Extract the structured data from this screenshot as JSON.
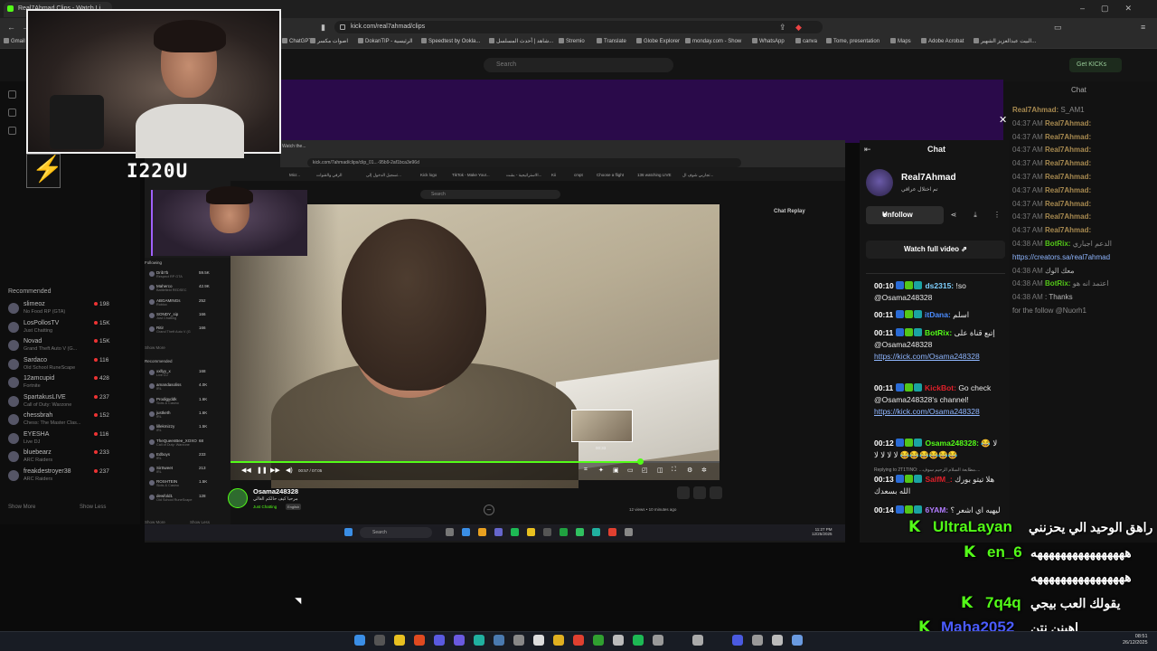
{
  "browser": {
    "tab_title": "Real7Ahmad Clips - Watch Li...",
    "url": "kick.com/real7ahmad/clips",
    "bookmarks": [
      "Gmail",
      "ChatGPT",
      "اصوات مكسر",
      "DokanTIP - الرئيسية",
      "Speedtest by Ookla...",
      "شاهد | أحدث المسلسل...",
      "Stremio",
      "Translate",
      "Globe Explorer",
      "monday.com - Show",
      "WhatsApp",
      "canva",
      "Tome, presentation",
      "Maps",
      "Adobe Acrobat",
      "البيت عبدالعزيز الشهير..."
    ]
  },
  "kick": {
    "search_placeholder": "Search",
    "get_kicks": "Get KICKs",
    "chat_title": "Chat",
    "recommended_heading": "Recommended",
    "recommended": [
      {
        "name": "slimeoz",
        "category": "No Food RP (GTA)",
        "viewers": "198"
      },
      {
        "name": "LosPollosTV",
        "category": "Just Chatting",
        "viewers": "15K"
      },
      {
        "name": "Novad",
        "category": "Grand Theft Auto V (G...",
        "viewers": "15K"
      },
      {
        "name": "Sardaco",
        "category": "Old School RuneScape",
        "viewers": "116"
      },
      {
        "name": "12amcupid",
        "category": "Fortnite",
        "viewers": "428"
      },
      {
        "name": "SpartakusLIVE",
        "category": "Call of Duty: Warzone",
        "viewers": "237"
      },
      {
        "name": "chessbrah",
        "category": "Chess: The Master Clas...",
        "viewers": "152"
      },
      {
        "name": "EYESHA",
        "category": "Live DJ",
        "viewers": "116"
      },
      {
        "name": "bluebearz",
        "category": "ARC Raiders",
        "viewers": "233"
      },
      {
        "name": "freakdestroyer38",
        "category": "ARC Raiders",
        "viewers": "237"
      }
    ],
    "show_more": "Show More",
    "show_less": "Show Less",
    "bg_chat": [
      {
        "time": "",
        "user": "Real7Ahmad:",
        "msg": "S_AM1",
        "style": "u"
      },
      {
        "time": "04:37 AM",
        "user": "Real7Ahmad:",
        "msg": "",
        "style": "u"
      },
      {
        "time": "04:37 AM",
        "user": "Real7Ahmad:",
        "msg": "",
        "style": "u"
      },
      {
        "time": "04:37 AM",
        "user": "Real7Ahmad:",
        "msg": "",
        "style": "u"
      },
      {
        "time": "04:37 AM",
        "user": "Real7Ahmad:",
        "msg": "",
        "style": "u"
      },
      {
        "time": "04:37 AM",
        "user": "Real7Ahmad:",
        "msg": "",
        "style": "u"
      },
      {
        "time": "04:37 AM",
        "user": "Real7Ahmad:",
        "msg": "",
        "style": "u"
      },
      {
        "time": "04:37 AM",
        "user": "Real7Ahmad:",
        "msg": "",
        "style": "u"
      },
      {
        "time": "04:37 AM",
        "user": "Real7Ahmad:",
        "msg": "",
        "style": "u"
      },
      {
        "time": "04:37 AM",
        "user": "Real7Ahmad:",
        "msg": "",
        "style": "u"
      },
      {
        "time": "04:38 AM",
        "user": "BotRix:",
        "msg": "الدعم اجباري",
        "style": "ub"
      },
      {
        "time": "",
        "user": "",
        "msg": "https://creators.sa/real7ahmad",
        "style": "link"
      },
      {
        "time": "04:38 AM",
        "user": "",
        "msg": "معك الوك",
        "style": "ur"
      },
      {
        "time": "04:38 AM",
        "user": "BotRix:",
        "msg": "اعتمد انه هو",
        "style": "ub"
      },
      {
        "time": "04:38 AM",
        "user": "",
        "msg": ": Thanks",
        "style": "ur"
      },
      {
        "time": "",
        "user": "",
        "msg": "for the follow @Nuorh1",
        "style": "plain"
      }
    ]
  },
  "modal": {
    "inner_url": "kick.com/7ahmad/clips/clip_01...-95b9-2af1bca3e96d",
    "inner_tab": "Watch the...",
    "inner_bookmarks": [
      "Micr...",
      "الرقي والقنوات",
      "تسجيل الدخول إلى...",
      "Kick logo",
      "TikTok - Make Your...",
      "الاستراتيجية - بشت...",
      "Kii",
      "cmpt",
      "Choose a flight",
      "136 watching LIVE",
      "تجاربي شوف ال..."
    ],
    "inner_search": "Search",
    "chat_replay": "Chat Replay",
    "inner_following_label": "Following",
    "inner_following": [
      {
        "name": "Drib7b",
        "category": "Respect RP GTA",
        "viewers": "59.5K"
      },
      {
        "name": "Maherco",
        "category": "Battlefield REDSEC",
        "viewers": "42.9K"
      },
      {
        "name": "ABGAMINGs",
        "category": "Roblox",
        "viewers": "252"
      },
      {
        "name": "SONDY_sip",
        "category": "Just Chatting",
        "viewers": "166"
      },
      {
        "name": "Ritir",
        "category": "Grand Theft Auto V (G",
        "viewers": "166"
      }
    ],
    "inner_show_more": "Show More",
    "inner_recommended_label": "Recommended",
    "inner_recommended": [
      {
        "name": "xxllyy_x",
        "category": "Live DJ",
        "viewers": "168"
      },
      {
        "name": "amandasoliss",
        "category": "IRL",
        "viewers": "4.0K"
      },
      {
        "name": "Prodigyddk",
        "category": "Slots & Casino",
        "viewers": "1.6K"
      },
      {
        "name": "justketh",
        "category": "IRL",
        "viewers": "1.6K"
      },
      {
        "name": "lillekmizzy",
        "category": "IRL",
        "viewers": "1.5K"
      },
      {
        "name": "TheQueenBee_XOXO",
        "category": "Call of Duty: Warzone",
        "viewers": "68"
      },
      {
        "name": "Edboys",
        "category": "IRL",
        "viewers": "233"
      },
      {
        "name": "SirSweet",
        "category": "IRL",
        "viewers": "213"
      },
      {
        "name": "ROSHTEIN",
        "category": "Slots & Casino",
        "viewers": "1.5K"
      },
      {
        "name": "dewfold1",
        "category": "Old School RuneScape",
        "viewers": "128"
      }
    ],
    "inner_show_more_2": "Show More",
    "inner_show_less": "Show Less",
    "player_time": "00:57 / 07:05",
    "progress_fraction": 0.837,
    "pip_time": "00:33",
    "clip_user": "Osama248328",
    "clip_title": "مرحبا كيف حالكم الغالي",
    "clip_category": "Just Chatting",
    "clip_language": "English",
    "clip_views": "12 views  •  10 minutes ago",
    "inner_task_search": "Search",
    "inner_clock": [
      "11:27 PM",
      "12/25/2025"
    ]
  },
  "chat_panel": {
    "title": "Chat",
    "streamer_name": "Real7Ahmad",
    "streamer_sub": "تم اختلال عراقي",
    "unfollow": "Unfollow",
    "watch_full": "Watch full video",
    "messages": [
      {
        "time": "00:10",
        "user": "ds2315:",
        "user_color": "#7ed0ff",
        "text": "!so @Osama248328",
        "link": ""
      },
      {
        "time": "00:11",
        "user": "itDana:",
        "user_color": "#4b8cff",
        "text": "اسلم",
        "link": ""
      },
      {
        "time": "00:11",
        "user": "BotRix:",
        "user_color": "#53fc18",
        "text": "إتبع قناة على @Osama248328",
        "link": "https://kick.com/Osama248328"
      },
      {
        "time": "00:11",
        "user": "KickBot:",
        "user_color": "#e0202a",
        "text": "Go check @Osama248328's channel!",
        "link": "https://kick.com/Osama248328"
      },
      {
        "time": "00:12",
        "user": "Osama248328:",
        "user_color": "#53fc18",
        "text": "لا 😂😂😂😂😂😂😂 لا لا لا لا",
        "link": ""
      },
      {
        "time": "00:13",
        "user": "SalfM_:",
        "user_color": "#e0202a",
        "text": "هلا تيتو بورك الله بسعدك",
        "link": ""
      },
      {
        "time": "00:14",
        "user": "6YAM:",
        "user_color": "#b27cff",
        "text": "ليهيه اي اشعر ؟",
        "link": ""
      }
    ],
    "reply_note": "Replying to 2T1TINO: ...مطابعة السلام الرحيم سوف...."
  },
  "overlay": {
    "streamer_tag": "I220U",
    "chat": [
      {
        "user": "UltraLayan",
        "msg": "راهق الوحيد الي يحزنني",
        "user_color": "#53fc18"
      },
      {
        "user": "en_6",
        "msg": "ههههههههههههههههه",
        "user_color": "#53fc18"
      },
      {
        "user": "",
        "msg": "ههههههههههههههههه",
        "user_color": "#53fc18"
      },
      {
        "user": "7q4q",
        "msg": "يقولك العب بيجي",
        "user_color": "#53fc18"
      },
      {
        "user": "Maha2052",
        "msg": "اهينن نتن",
        "user_color": "#4b5cff"
      }
    ]
  },
  "taskbar": {
    "clock": [
      "08:51",
      "26/12/2025"
    ]
  }
}
